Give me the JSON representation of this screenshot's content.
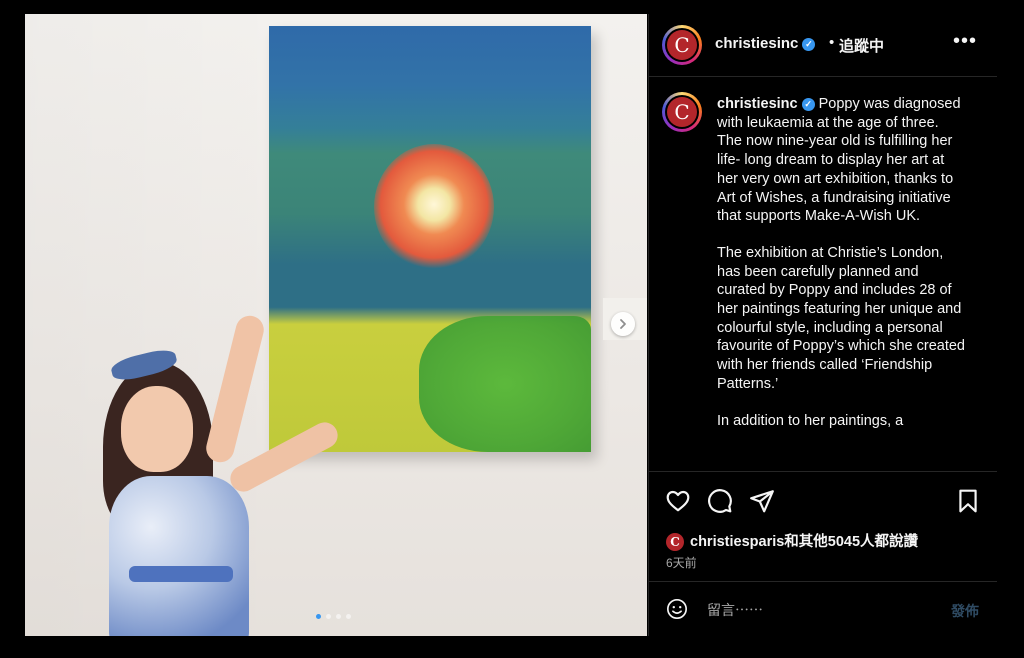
{
  "post": {
    "username": "christiesinc",
    "follow_status": "追蹤中",
    "separator": "•",
    "more_icon": "more-horizontal-icon",
    "caption_paragraphs": [
      "Poppy was diagnosed with leukaemia at the age of three. The now nine-year old is fulfilling her life- long dream to display her art at her very own art exhibition, thanks to Art of Wishes, a fundraising initiative that supports Make-A-Wish UK.",
      "The exhibition at Christie’s London, has been carefully planned and curated by Poppy and includes 28 of her paintings featuring her unique and colourful style, including a personal favourite of Poppy’s which she created with her friends called ‘Friendship Patterns.’",
      "In addition to her paintings, a"
    ],
    "likes_text": "christiesparis和其他5045人都說讚",
    "time_ago": "6天前",
    "avatar_letter": "C"
  },
  "carousel": {
    "total_slides": 4,
    "active_slide": 1
  },
  "comment": {
    "placeholder": "留言⋯⋯",
    "post_label": "發佈"
  },
  "colors": {
    "verified": "#3897f0",
    "brand": "#b3262b",
    "post_disabled": "#2f4b63"
  }
}
